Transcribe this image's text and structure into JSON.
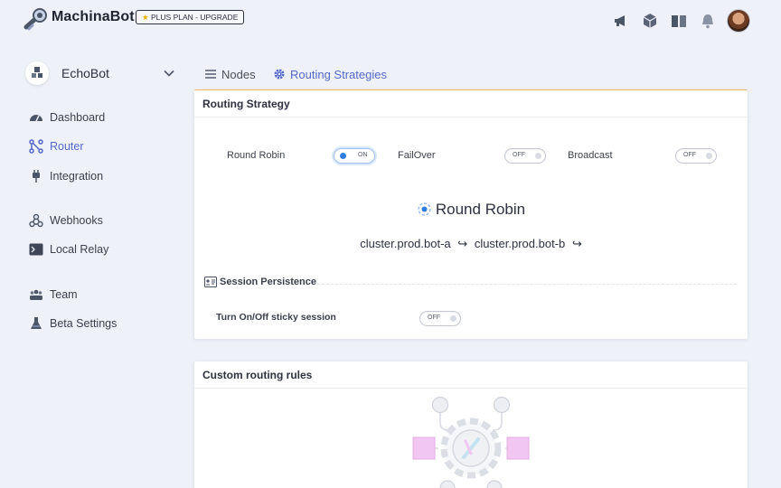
{
  "app": {
    "brand_bold": "MachinaBot",
    "plan_badge": "PLUS PLAN - UPGRADE"
  },
  "header": {
    "icons": [
      "megaphone-icon",
      "cube-icon",
      "book-icon",
      "bell-icon"
    ]
  },
  "bot": {
    "name": "EchoBot"
  },
  "sidebar": {
    "items": [
      {
        "label": "Dashboard",
        "icon": "dashboard-icon",
        "active": false
      },
      {
        "label": "Router",
        "icon": "router-icon",
        "active": true
      },
      {
        "label": "Integration",
        "icon": "plug-icon",
        "active": false
      },
      {
        "label": "Webhooks",
        "icon": "webhook-icon",
        "active": false
      },
      {
        "label": "Local Relay",
        "icon": "terminal-icon",
        "active": false
      },
      {
        "label": "Team",
        "icon": "team-icon",
        "active": false
      },
      {
        "label": "Beta Settings",
        "icon": "flask-icon",
        "active": false
      }
    ]
  },
  "tabs": [
    {
      "label": "Nodes",
      "icon": "list-icon",
      "active": false
    },
    {
      "label": "Routing Strategies",
      "icon": "gear-icon",
      "active": true
    }
  ],
  "routing": {
    "title": "Routing Strategy",
    "strategies": [
      {
        "label": "Round Robin",
        "state": "ON",
        "on": true
      },
      {
        "label": "FailOver",
        "state": "OFF",
        "on": false
      },
      {
        "label": "Broadcast",
        "state": "OFF",
        "on": false
      }
    ],
    "selected_strategy": "Round Robin",
    "cluster_a": "cluster.prod.bot-a",
    "cluster_b": "cluster.prod.bot-b",
    "arrow": "↪",
    "session": {
      "heading": "Session Persistence",
      "sticky_label": "Turn On/Off sticky session",
      "sticky_state": "OFF"
    }
  },
  "custom_rules": {
    "title": "Custom routing rules"
  },
  "colors": {
    "accent": "#5468c9",
    "toggle_on": "#2f7de1",
    "card_top_border": "#f3b86b",
    "background": "#eef1f8"
  }
}
